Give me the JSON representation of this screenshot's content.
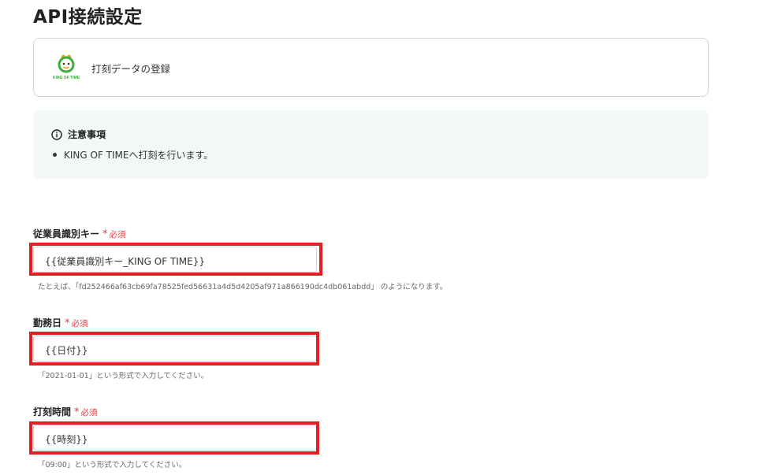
{
  "page": {
    "title": "API接続設定"
  },
  "app": {
    "logo_text": "KING OF TIME",
    "action_label": "打刻データの登録"
  },
  "notice": {
    "title": "注意事項",
    "items": [
      "KING OF TIMEへ打刻を行います。"
    ]
  },
  "fields": [
    {
      "label": "従業員識別キー",
      "required_label": "必須",
      "value": "{{従業員識別キー_KING OF TIME}}",
      "hint": "たとえば、「fd252466af63cb69fa78525fed56631a4d5d4205af971a866190dc4db061abdd」 のようになります。"
    },
    {
      "label": "勤務日",
      "required_label": "必須",
      "value": "{{日付}}",
      "hint": "「2021-01-01」という形式で入力してください。"
    },
    {
      "label": "打刻時間",
      "required_label": "必須",
      "value": "{{時刻}}",
      "hint": "「09:00」という形式で入力してください。"
    }
  ],
  "colors": {
    "highlight": "#e02025",
    "required": "#e03b3b",
    "notice_bg": "#f1f8f6"
  }
}
